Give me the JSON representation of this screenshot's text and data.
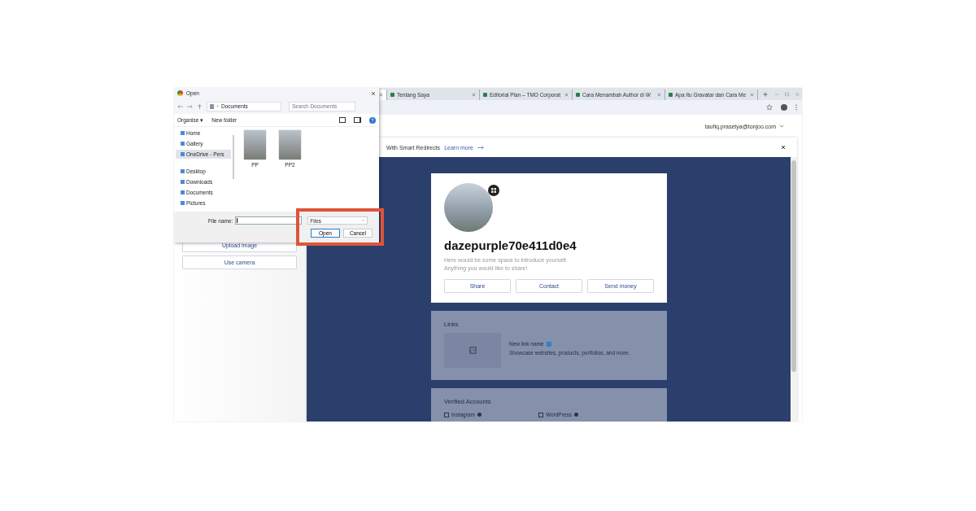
{
  "browser": {
    "tabs": [
      {
        "selected": true
      },
      {
        "title": "Tentang Saya",
        "selected": false
      },
      {
        "title": "Editorial Plan – TMO Corporat",
        "selected": false
      },
      {
        "title": "Cara Menambah Author di W",
        "selected": false
      },
      {
        "title": "Apa Itu Gravatar dan Cara Me",
        "selected": false
      }
    ],
    "account": "taufiq.prasetya@tonjoo.com"
  },
  "left_panel": {
    "buttons": [
      "Upload image",
      "Use camera"
    ]
  },
  "banner": {
    "text": "With Smart Redirects",
    "link": "Learn more"
  },
  "profile": {
    "name": "dazepurple70e411d0e4",
    "bio": [
      "Here would be some space to introduce yourself.",
      "Anything you would like to share!"
    ],
    "buttons": [
      "Share",
      "Contact",
      "Send money"
    ]
  },
  "links": {
    "title": "Links",
    "item": {
      "name": "New link name",
      "description": "Showcase websites, products, portfolios, and more."
    }
  },
  "verified": {
    "title": "Verified Accounts",
    "accounts": [
      "Instagram",
      "WordPress"
    ]
  },
  "dialog": {
    "title": "Open",
    "path": "Documents",
    "search": {
      "placeholder": "Search Documents"
    },
    "toolbar": [
      "Organise ▾",
      "New folder"
    ],
    "nav_groups": [
      {
        "items": [
          {
            "label": "Home",
            "selected": false
          },
          {
            "label": "Gallery",
            "selected": false
          },
          {
            "label": "OneDrive - Pers",
            "selected": true
          }
        ]
      },
      {
        "items": [
          {
            "label": "Desktop",
            "selected": false
          },
          {
            "label": "Downloads",
            "selected": false
          },
          {
            "label": "Documents",
            "selected": false
          },
          {
            "label": "Pictures",
            "selected": false
          }
        ]
      }
    ],
    "files": [
      "PP",
      "PP2"
    ],
    "file_name_label": "File name:",
    "filter": "Files",
    "buttons": [
      "Open",
      "Cancel"
    ]
  }
}
